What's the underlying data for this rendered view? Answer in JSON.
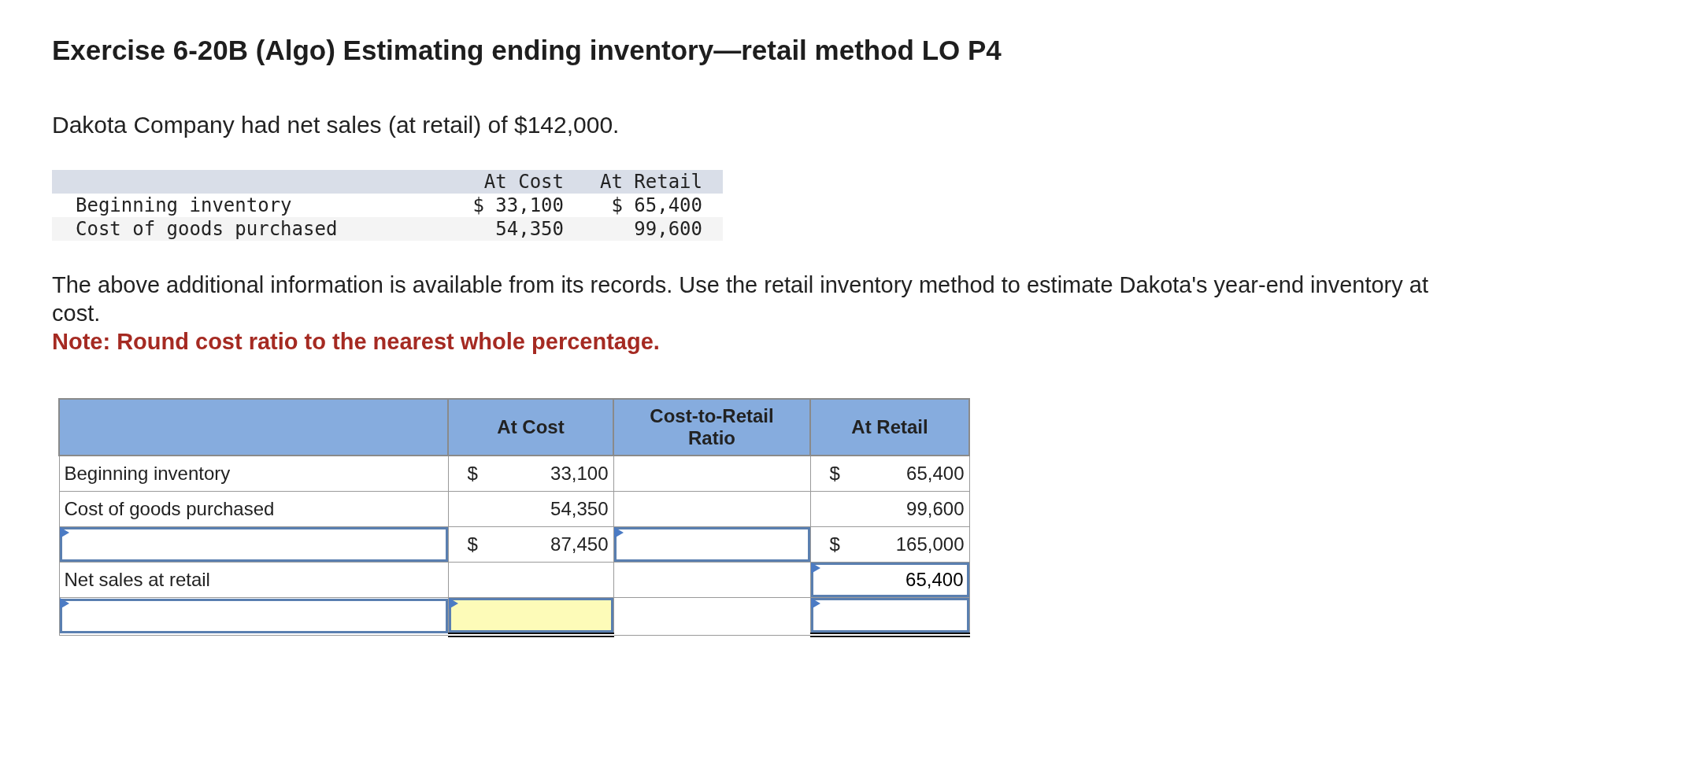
{
  "title": "Exercise 6-20B (Algo) Estimating ending inventory—retail method LO P4",
  "intro": "Dakota Company had net sales (at retail) of $142,000.",
  "given_table": {
    "columns": [
      "",
      "At Cost",
      "At Retail"
    ],
    "rows": [
      {
        "cells": [
          "Beginning inventory",
          "$ 33,100",
          "$ 65,400"
        ]
      },
      {
        "cells": [
          "Cost of goods purchased",
          "54,350",
          "99,600"
        ]
      }
    ]
  },
  "instructions": "The above additional information is available from its records. Use the retail inventory method to estimate Dakota's year-end inventory at cost.",
  "note": "Note: Round cost ratio to the nearest whole percentage.",
  "answer_table": {
    "columns": [
      "",
      "At Cost",
      "Cost-to-Retail Ratio",
      "At Retail"
    ],
    "rows": [
      {
        "cells": [
          {
            "kind": "label",
            "text": "Beginning inventory"
          },
          {
            "kind": "amount",
            "currency": "$",
            "value": "33,100"
          },
          {
            "kind": "blank"
          },
          {
            "kind": "amount",
            "currency": "$",
            "value": "65,400"
          }
        ]
      },
      {
        "cells": [
          {
            "kind": "label",
            "text": "Cost of goods purchased"
          },
          {
            "kind": "amount",
            "value": "54,350"
          },
          {
            "kind": "blank"
          },
          {
            "kind": "amount",
            "value": "99,600"
          }
        ]
      },
      {
        "cells": [
          {
            "kind": "input",
            "highlighted": false
          },
          {
            "kind": "amount",
            "currency": "$",
            "value": "87,450"
          },
          {
            "kind": "input",
            "highlighted": false
          },
          {
            "kind": "amount",
            "currency": "$",
            "value": "165,000"
          }
        ]
      },
      {
        "cells": [
          {
            "kind": "wide-label",
            "text": "Net sales at retail"
          },
          {
            "kind": "open"
          },
          {
            "kind": "open"
          },
          {
            "kind": "input",
            "value": "65,400",
            "highlighted": false
          }
        ]
      },
      {
        "cells": [
          {
            "kind": "input",
            "highlighted": false
          },
          {
            "kind": "input",
            "highlighted": true,
            "double_underline": true
          },
          {
            "kind": "blank"
          },
          {
            "kind": "input",
            "highlighted": false,
            "double_underline": true
          }
        ]
      }
    ]
  }
}
